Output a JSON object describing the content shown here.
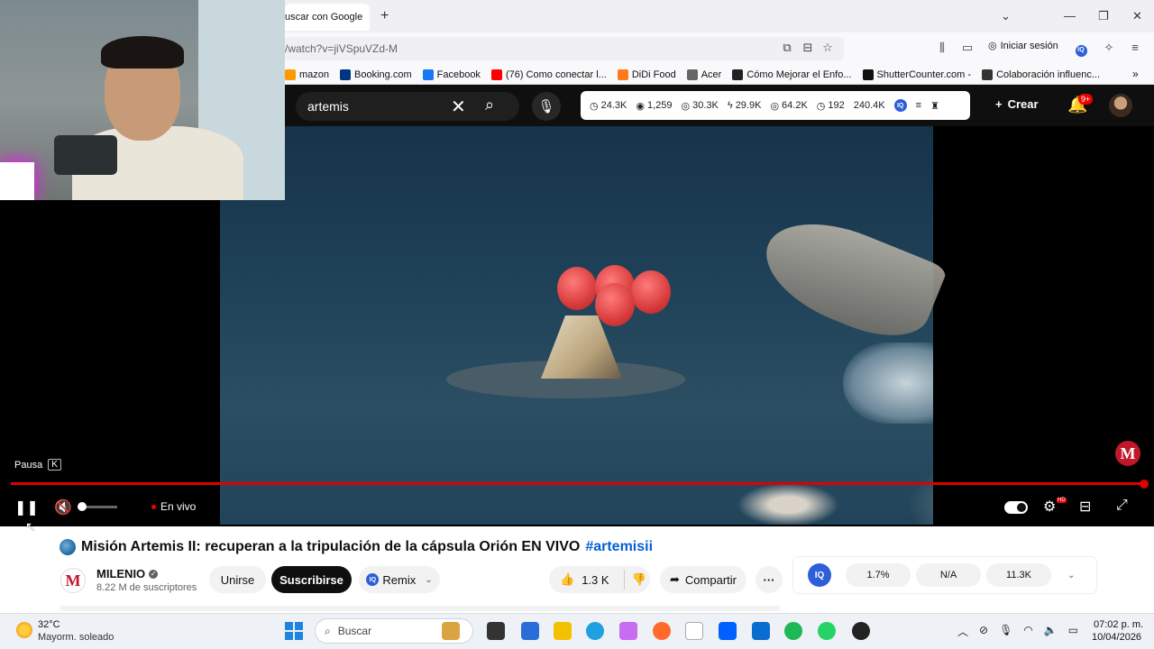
{
  "browser": {
    "tab_title": "uscar con Google",
    "url": "/watch?v=jiVSpuVZd-M",
    "signin_label": "Iniciar sesión",
    "bookmarks": [
      {
        "label": "mazon",
        "color": "#ff9900"
      },
      {
        "label": "Booking.com",
        "color": "#003580"
      },
      {
        "label": "Facebook",
        "color": "#1877f2"
      },
      {
        "label": "(76) Como conectar l...",
        "color": "#ff0000"
      },
      {
        "label": "DiDi Food",
        "color": "#ff7a1a"
      },
      {
        "label": "Acer",
        "color": "#666666"
      },
      {
        "label": "Cómo Mejorar el Enfo...",
        "color": "#222222"
      },
      {
        "label": "ShutterCounter.com -",
        "color": "#111111"
      },
      {
        "label": "Colaboración influenc...",
        "color": "#333333"
      }
    ]
  },
  "youtube": {
    "search_value": "artemis",
    "stats": [
      "24.3K",
      "1,259",
      "30.3K",
      "29.9K",
      "64.2K",
      "192",
      "240.4K"
    ],
    "create_label": "Crear",
    "notif_badge": "9+"
  },
  "player": {
    "pause_label": "Pausa",
    "pause_key": "K",
    "live_label": "En vivo",
    "hd_badge": "HD",
    "progress": 1.0,
    "volume": 0.0
  },
  "video_info": {
    "title": "Misión Artemis II: recuperan a la tripulación de la cápsula Orión EN VIVO",
    "hashtag": "#artemisii",
    "channel": "MILENIO",
    "channel_initial": "M",
    "subscribers": "8.22 M de suscriptores",
    "join_label": "Unirse",
    "subscribe_label": "Suscribirse",
    "remix_label": "Remix",
    "likes": "1.3 K",
    "share_label": "Compartir",
    "iq_label": "IQ",
    "iq_stats": [
      "1.7%",
      "N/A",
      "11.3K"
    ]
  },
  "taskbar": {
    "temp": "32°C",
    "weather": "Mayorm. soleado",
    "search_placeholder": "Buscar",
    "time": "07:02 p. m.",
    "date": "10/04/2026"
  }
}
